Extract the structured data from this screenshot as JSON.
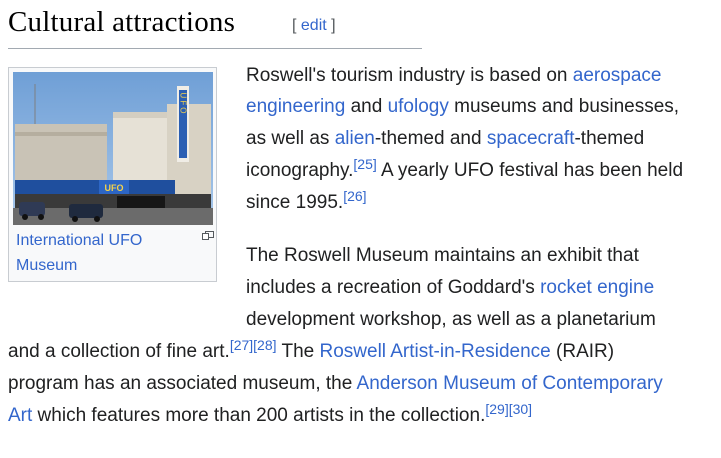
{
  "section": {
    "title": "Cultural attractions",
    "edit_open": "[ ",
    "edit_label": "edit",
    "edit_close": " ]"
  },
  "figure": {
    "caption": "International UFO Museum",
    "sign_text": "UFO",
    "icons": {
      "magnify": "magnify-clip-icon"
    }
  },
  "p1": {
    "l1_a": "Roswell's tourism industry is based on ",
    "l1_link": "aerospace",
    "l2_link1": "engineering",
    "l2_b": " and ",
    "l2_link2": "ufology",
    "l2_c": " museums and businesses,",
    "l3_a": "as well as ",
    "l3_link1": "alien",
    "l3_b": "-themed and ",
    "l3_link2": "spacecraft",
    "l3_c": "-themed",
    "l4_a": "iconography.",
    "l4_ref": "[25]",
    "l4_b": " A yearly UFO festival has been held",
    "l5_a": "since 1995.",
    "l5_ref": "[26]"
  },
  "p2": {
    "l1": "The Roswell Museum maintains an exhibit that",
    "l2_a": "includes a recreation of Goddard's ",
    "l2_link": "rocket engine",
    "l3": "development workshop, as well as a planetarium",
    "l4_a": "and a collection of fine art.",
    "l4_ref1": "[27]",
    "l4_ref2": "[28]",
    "l4_b": " The ",
    "l4_link": "Roswell Artist-in-Residence",
    "l4_c": " (RAIR)",
    "l5_a": "program has an associated museum, the ",
    "l5_link": "Anderson Museum of Contemporary",
    "l6_link": "Art",
    "l6_b": " which features more than 200 artists in the collection.",
    "l6_ref1": "[29]",
    "l6_ref2": "[30]"
  }
}
